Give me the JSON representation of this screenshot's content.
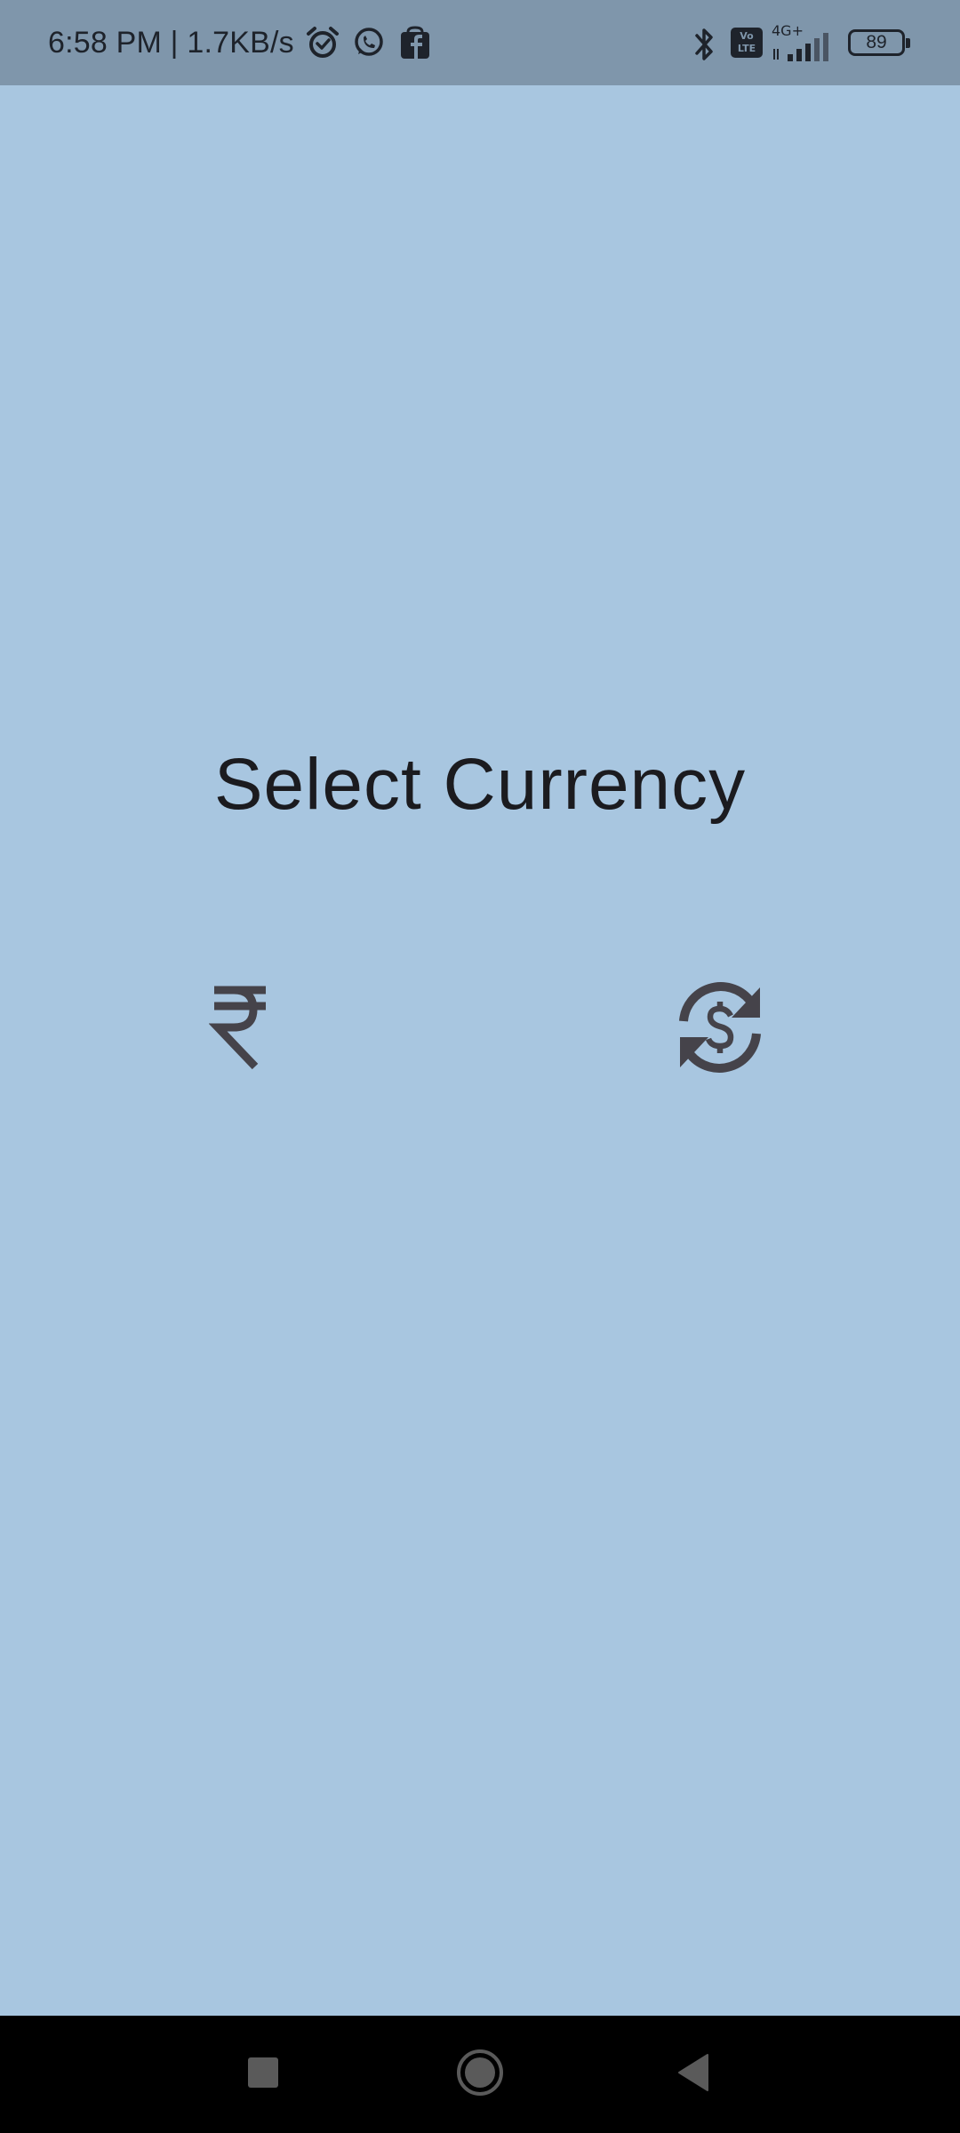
{
  "status_bar": {
    "time_and_speed": "6:58 PM | 1.7KB/s",
    "icons": [
      "alarm-icon",
      "whatsapp-icon",
      "facebook-icon"
    ],
    "right_icons": [
      "bluetooth-icon",
      "volte-icon",
      "signal-icon",
      "battery-icon"
    ],
    "volte_label_top": "Vo",
    "volte_label_bottom": "LTE",
    "network_label": "4G+",
    "battery_level": "89"
  },
  "main": {
    "title": "Select Currency",
    "options": [
      {
        "name": "rupee-icon"
      },
      {
        "name": "currency-exchange-icon"
      }
    ]
  },
  "nav_bar": {
    "buttons": [
      "recents-button",
      "home-button",
      "back-button"
    ]
  },
  "colors": {
    "background": "#a8c6e0",
    "status_bar": "#7f96ab",
    "icon": "#45434a",
    "text": "#1b1b1f",
    "nav_bar": "#000000"
  }
}
